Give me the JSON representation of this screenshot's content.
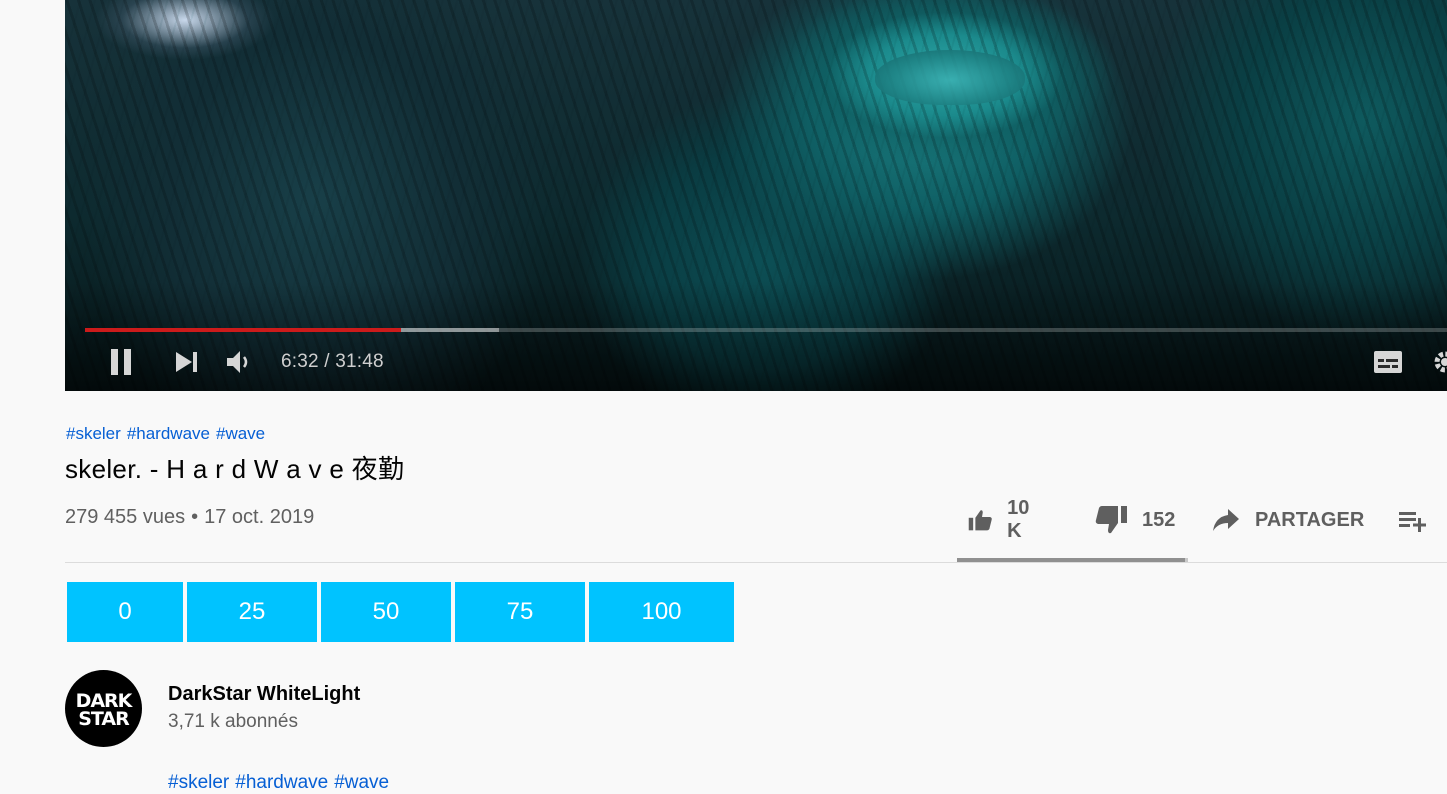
{
  "player": {
    "time_current": "6:32",
    "time_separator": " / ",
    "time_total": "31:48",
    "progress_fraction": 0.232,
    "buffer_fraction": 0.304,
    "accent_color": "#cc1b1b"
  },
  "video": {
    "hashtags": [
      "#skeler",
      "#hardwave",
      "#wave"
    ],
    "title": "skeler. - H a r d W a v e 夜勤",
    "views": "279 455 vues",
    "separator": "•",
    "date": "17 oct. 2019"
  },
  "actions": {
    "like_count": "10 K",
    "dislike_count": "152",
    "share_label": "PARTAGER",
    "like_fraction": 0.985
  },
  "seek_buttons": [
    "0",
    "25",
    "50",
    "75",
    "100"
  ],
  "seek_button_color": "#00c3ff",
  "channel": {
    "name": "DarkStar WhiteLight",
    "subscribers": "3,71 k abonnés",
    "logo_text_line1": "DARK",
    "logo_text_line2": "STAR"
  },
  "description": {
    "hashtags": [
      "#skeler",
      "#hardwave",
      "#wave"
    ]
  },
  "icons": {
    "pause": "pause-icon",
    "next": "next-icon",
    "volume": "volume-icon",
    "subtitles": "subtitles-icon",
    "settings": "settings-icon",
    "like": "thumb-up-icon",
    "dislike": "thumb-down-icon",
    "share": "share-arrow-icon",
    "save": "playlist-add-icon"
  }
}
